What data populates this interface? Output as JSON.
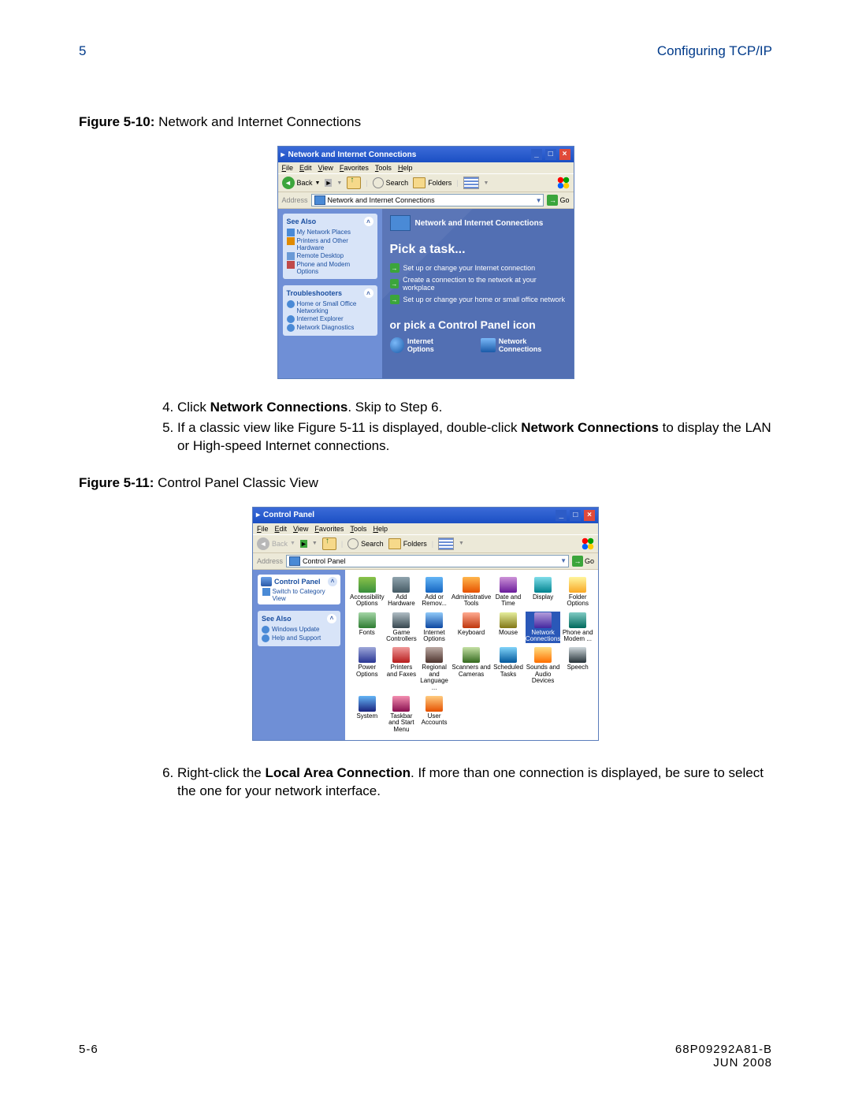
{
  "header": {
    "chapter": "5",
    "section": "Configuring TCP/IP"
  },
  "fig1": {
    "labelBold": "Figure 5-10:",
    "labelRest": " Network and Internet Connections"
  },
  "win1": {
    "title": "Network and Internet Connections",
    "menu": [
      "File",
      "Edit",
      "View",
      "Favorites",
      "Tools",
      "Help"
    ],
    "back": "Back",
    "search": "Search",
    "folders": "Folders",
    "addressLabel": "Address",
    "addressValue": "Network and Internet Connections",
    "go": "Go",
    "seeAlso": {
      "title": "See Also",
      "items": [
        "My Network Places",
        "Printers and Other Hardware",
        "Remote Desktop",
        "Phone and Modem Options"
      ]
    },
    "troubleshooters": {
      "title": "Troubleshooters",
      "items": [
        "Home or Small Office Networking",
        "Internet Explorer",
        "Network Diagnostics"
      ]
    },
    "heading": "Network and Internet Connections",
    "pick": "Pick a task...",
    "tasks": [
      "Set up or change your Internet connection",
      "Create a connection to the network at your workplace",
      "Set up or change your home or small office network"
    ],
    "or": "or pick a Control Panel icon",
    "icons": [
      "Internet Options",
      "Network Connections"
    ]
  },
  "steps1": {
    "s4a": "Click ",
    "s4b": "Network Connections",
    "s4c": ". Skip to Step 6.",
    "s5a": "If a classic view like Figure 5-11 is displayed, double-click ",
    "s5b": "Network Connections",
    "s5c": " to display the LAN or High-speed Internet connections."
  },
  "fig2": {
    "labelBold": "Figure 5-11:",
    "labelRest": " Control Panel Classic View"
  },
  "win2": {
    "title": "Control Panel",
    "menu": [
      "File",
      "Edit",
      "View",
      "Favorites",
      "Tools",
      "Help"
    ],
    "back": "Back",
    "search": "Search",
    "folders": "Folders",
    "addressLabel": "Address",
    "addressValue": "Control Panel",
    "go": "Go",
    "cpTitle": "Control Panel",
    "switchView": "Switch to Category View",
    "seeAlso": {
      "title": "See Also",
      "items": [
        "Windows Update",
        "Help and Support"
      ]
    },
    "grid": [
      "Accessibility Options",
      "Add Hardware",
      "Add or Remov...",
      "Administrative Tools",
      "Date and Time",
      "Display",
      "Folder Options",
      "Fonts",
      "Game Controllers",
      "Internet Options",
      "Keyboard",
      "Mouse",
      "Network Connections",
      "Phone and Modem ...",
      "Power Options",
      "Printers and Faxes",
      "Regional and Language ...",
      "Scanners and Cameras",
      "Scheduled Tasks",
      "Sounds and Audio Devices",
      "Speech",
      "System",
      "Taskbar and Start Menu",
      "User Accounts"
    ],
    "selectedIndex": 12
  },
  "steps2": {
    "s6a": "Right-click the ",
    "s6b": "Local Area Connection",
    "s6c": ". If more than one connection is displayed, be sure to select the one for your network interface."
  },
  "footer": {
    "left": "5-6",
    "right1": "68P09292A81-B",
    "right2": "JUN 2008"
  }
}
